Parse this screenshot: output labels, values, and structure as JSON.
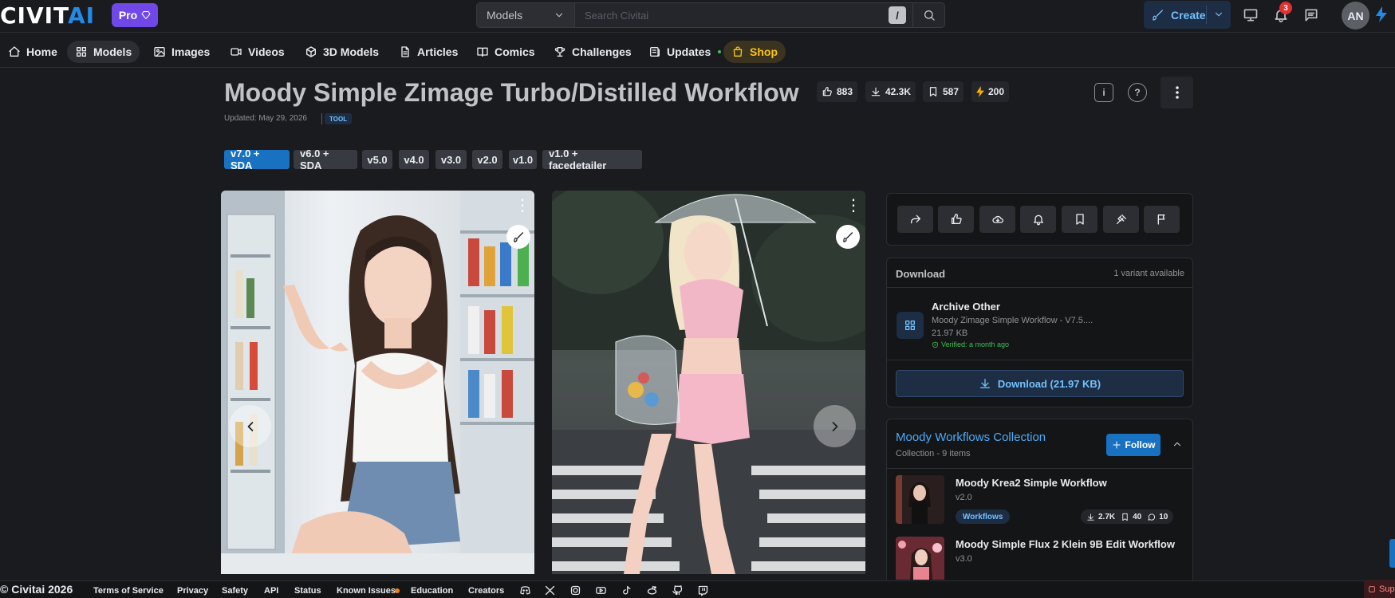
{
  "header": {
    "logo_main": "CIVIT",
    "logo_ai": "AI",
    "pro_label": "Pro",
    "search_category": "Models",
    "search_placeholder": "Search Civitai",
    "search_shortcut": "/",
    "create_label": "Create",
    "notification_count": "3",
    "avatar_initials": "AN"
  },
  "nav": [
    {
      "label": "Home",
      "icon": "home-icon"
    },
    {
      "label": "Models",
      "icon": "grid-icon",
      "active": true
    },
    {
      "label": "Images",
      "icon": "image-icon"
    },
    {
      "label": "Videos",
      "icon": "video-icon"
    },
    {
      "label": "3D Models",
      "icon": "cube-icon"
    },
    {
      "label": "Articles",
      "icon": "file-text-icon"
    },
    {
      "label": "Comics",
      "icon": "book-icon"
    },
    {
      "label": "Challenges",
      "icon": "trophy-icon"
    },
    {
      "label": "Updates",
      "icon": "news-icon"
    },
    {
      "label": "Shop",
      "icon": "shopping-bag-icon"
    }
  ],
  "model": {
    "title": "Moody Simple Zimage Turbo/Distilled Workflow",
    "stats": {
      "likes": "883",
      "downloads": "42.3K",
      "bookmarks": "587",
      "buzz": "200"
    },
    "updated": "Updated: May 29, 2026",
    "type_badge": "TOOL",
    "versions": [
      "v7.0 + SDA",
      "v6.0 + SDA",
      "v5.0",
      "v4.0",
      "v3.0",
      "v2.0",
      "v1.0",
      "v1.0 + facedetailer"
    ]
  },
  "download": {
    "heading": "Download",
    "variants": "1 variant available",
    "file_type": "Archive Other",
    "file_name": "Moody Zimage Simple Workflow - V7.5....",
    "file_size": "21.97 KB",
    "verified": "Verified: a month ago",
    "button": "Download (21.97 KB)"
  },
  "collection": {
    "title": "Moody Workflows Collection",
    "subtitle": "Collection - 9 items",
    "follow": "Follow",
    "items": [
      {
        "name": "Moody Krea2 Simple Workflow",
        "version": "v2.0",
        "tag": "Workflows",
        "downloads": "2.7K",
        "bookmarks": "40",
        "comments": "10"
      },
      {
        "name": "Moody Simple Flux 2 Klein 9B Edit Workflow",
        "version": "v3.0"
      }
    ]
  },
  "footer": {
    "copyright": "© Civitai 2026",
    "links": [
      "Terms of Service",
      "Privacy",
      "Safety",
      "API",
      "Status",
      "Known Issues",
      "Education",
      "Creators"
    ],
    "support": "Sup"
  },
  "colors": {
    "accent": "#228be6",
    "pro": "#7048e8",
    "shop": "#fcc419",
    "notification": "#e03131"
  }
}
